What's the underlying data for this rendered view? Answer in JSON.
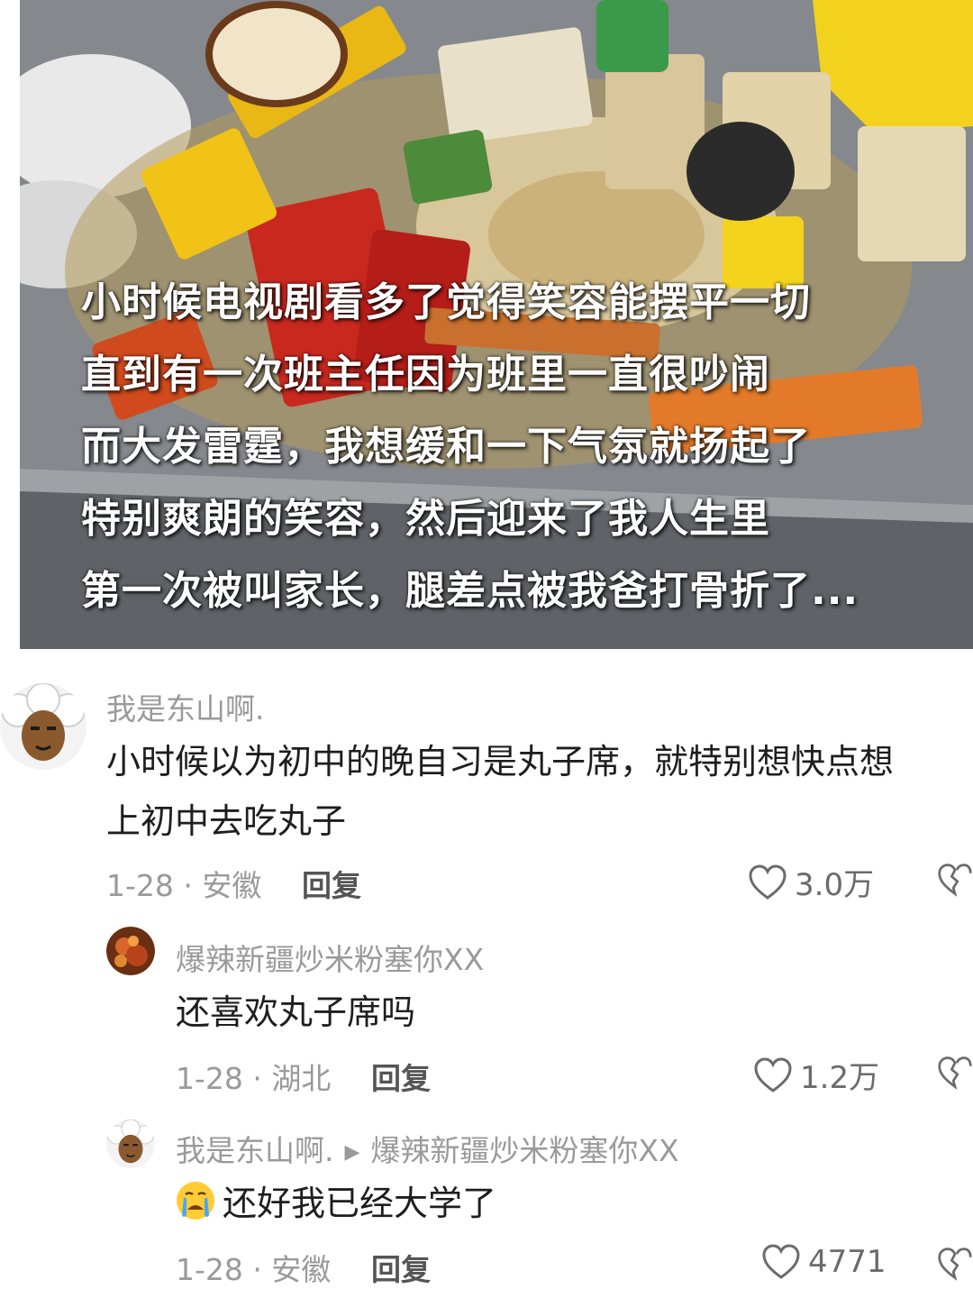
{
  "video": {
    "caption_lines": [
      "小时候电视剧看多了觉得笑容能摆平一切",
      "直到有一次班主任因为班里一直很吵闹",
      "而大发雷霆，我想缓和一下气氛就扬起了",
      "特别爽朗的笑容，然后迎来了我人生里",
      "第一次被叫家长，腿差点被我爸打骨折了..."
    ]
  },
  "comments": [
    {
      "author": "我是东山啊.",
      "text": "小时候以为初中的晚自习是丸子席，就特别想快点想上初中去吃丸子",
      "text_line1": "小时候以为初中的晚自习是丸子席，就特别想快点想",
      "text_line2": "上初中去吃丸子",
      "date_location": "1-28 · 安徽",
      "reply_label": "回复",
      "likes": "3.0万"
    },
    {
      "author": "爆辣新疆炒米粉塞你XX",
      "text": "还喜欢丸子席吗",
      "date_location": "1-28 · 湖北",
      "reply_label": "回复",
      "likes": "1.2万"
    },
    {
      "author": "我是东山啊.",
      "reply_to": "爆辣新疆炒米粉塞你XX",
      "emoji": "crying-face",
      "text": "还好我已经大学了",
      "date_location": "1-28 · 安徽",
      "reply_label": "回复",
      "likes": "4771"
    }
  ],
  "colors": {
    "meta_gray": "#9a9a9a",
    "text_dark": "#1e1e1e",
    "caption_white": "#ffffff"
  }
}
